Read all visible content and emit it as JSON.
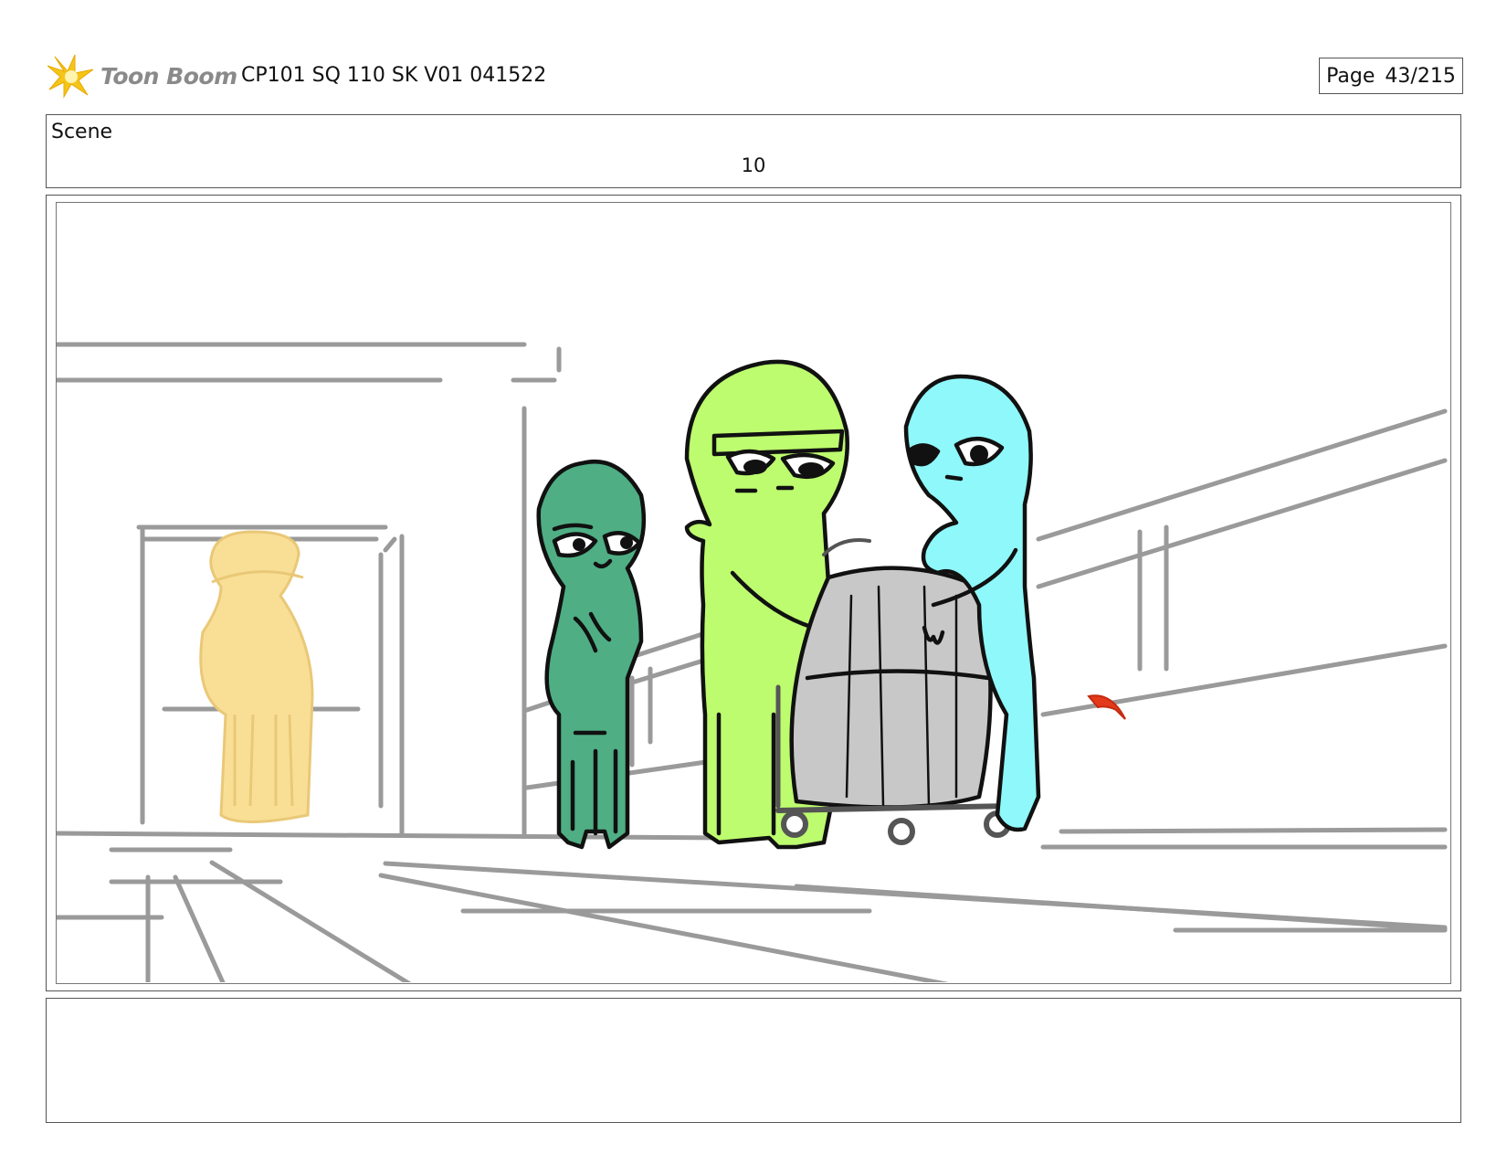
{
  "header": {
    "logo_text": "Toon Boom",
    "project_title": "CP101 SQ 110 SK V01 041522",
    "page_label": "Page",
    "page_value": "43/215"
  },
  "scene": {
    "label": "Scene",
    "number": "10"
  },
  "notes": {
    "text": ""
  },
  "colors": {
    "logo_star": "#f5c518",
    "logo_text": "#8a8a8a",
    "character_dark_green": "#4fae84",
    "character_lime": "#bdfc6e",
    "character_cyan": "#8ff8fb",
    "character_yellow": "#f9df96",
    "barrel_gray": "#c8c8c8",
    "sketch_lines": "#9a9a9a",
    "red_mark": "#e23a1a"
  },
  "icons": {
    "logo": "toon-boom-star-icon"
  }
}
